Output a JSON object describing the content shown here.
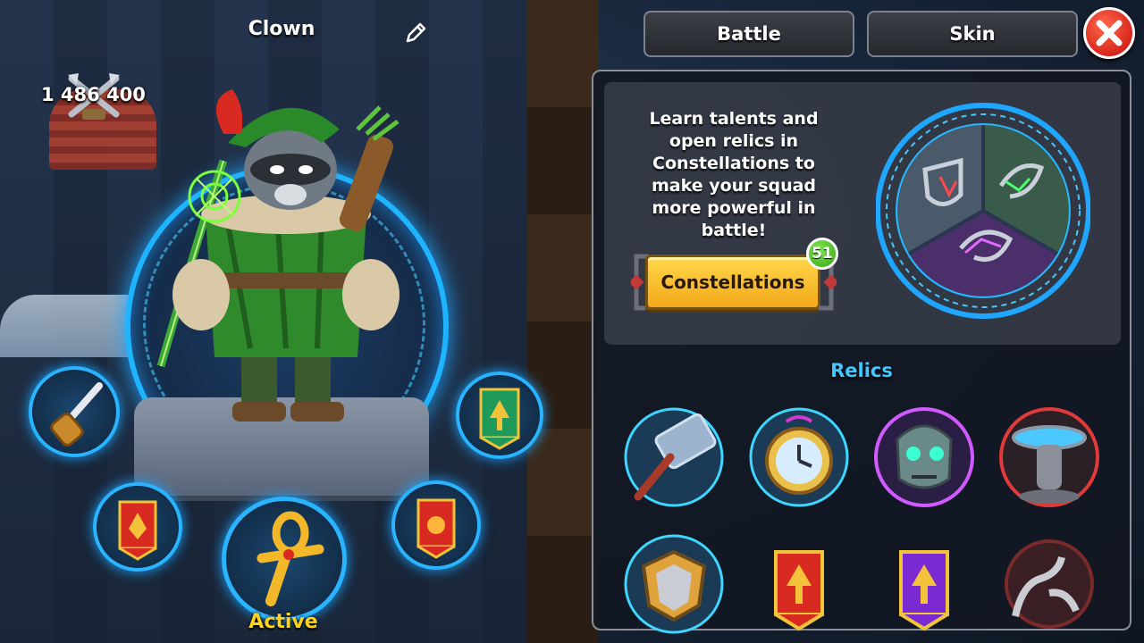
{
  "hero": {
    "name": "Clown",
    "power": "1 486 400",
    "active_label": "Active"
  },
  "tabs": [
    {
      "label": "Battle"
    },
    {
      "label": "Skin"
    }
  ],
  "constellations": {
    "description": "Learn talents and open relics in Constellations to make your squad more powerful in battle!",
    "button_label": "Constellations",
    "badge_count": "51"
  },
  "relics": {
    "title": "Relics"
  },
  "icons": {
    "edit": "pencil-icon",
    "power": "crossed-axes-icon",
    "close": "close-icon"
  },
  "colors": {
    "accent_blue": "#40c8ff",
    "button_yellow": "#f3a81a",
    "close_red": "#d8261c",
    "active_gold": "#ffd21e"
  }
}
